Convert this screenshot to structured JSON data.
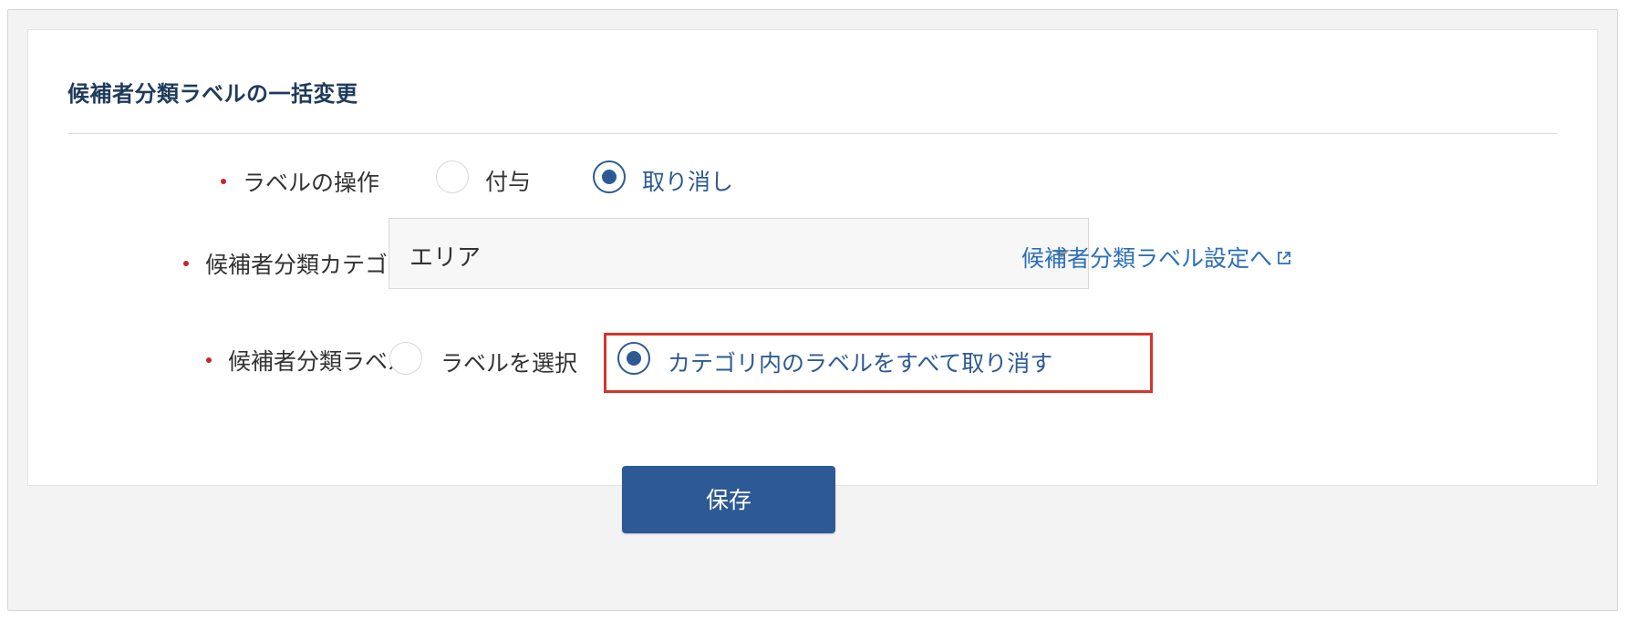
{
  "form": {
    "title": "候補者分類ラベルの一括変更",
    "operation": {
      "label": "ラベルの操作",
      "options": [
        {
          "label": "付与",
          "selected": false
        },
        {
          "label": "取り消し",
          "selected": true
        }
      ]
    },
    "category": {
      "label": "候補者分類カテゴリ",
      "value": "エリア",
      "link_label": "候補者分類ラベル設定へ"
    },
    "classification_label": {
      "label": "候補者分類ラベル",
      "options": [
        {
          "label": "ラベルを選択",
          "selected": false
        },
        {
          "label": "カテゴリ内のラベルをすべて取り消す",
          "selected": true
        }
      ]
    },
    "save_label": "保存"
  },
  "colors": {
    "accent": "#2d5a95",
    "link": "#2d6fb8",
    "required": "#c0282d",
    "highlight": "#d8332a"
  },
  "icons": {
    "external_link": "external-link-icon",
    "dropdown": "chevron-down-icon"
  }
}
